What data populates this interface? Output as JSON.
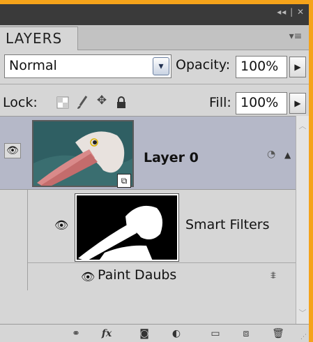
{
  "title_bar": {
    "controls": "◂◂ | ✕"
  },
  "tab": {
    "label": "LAYERS",
    "menu_icon": "panel-menu-icon"
  },
  "blend": {
    "value": "Normal",
    "arrow": "▾"
  },
  "opacity": {
    "label": "Opacity:",
    "value": "100%"
  },
  "lock": {
    "label": "Lock:"
  },
  "fill": {
    "label": "Fill:",
    "value": "100%"
  },
  "layer": {
    "name": "Layer 0",
    "visible": true
  },
  "smart_filters": {
    "label": "Smart Filters"
  },
  "filter": {
    "name": "Paint Daubs"
  },
  "footer": {
    "buttons": [
      "link-layers-icon",
      "fx-icon",
      "add-mask-icon",
      "adjustment-layer-icon",
      "new-group-icon",
      "new-layer-icon",
      "delete-icon"
    ],
    "fx_label": "fx"
  },
  "colors": {
    "panel_bg": "#d6d6d6",
    "selected_row": "#b5b8c8",
    "title_bar": "#3a3a3a",
    "frame_accent": "#f5a31a"
  }
}
